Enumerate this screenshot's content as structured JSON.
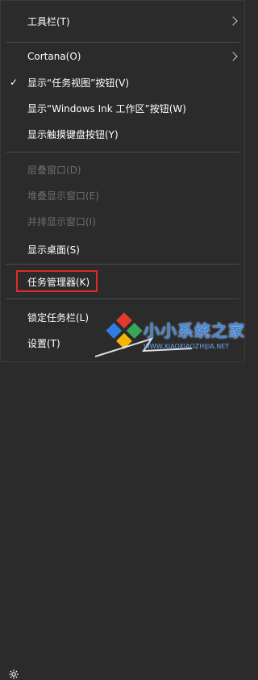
{
  "menu": {
    "items": [
      {
        "label": "工具栏(T)",
        "submenu": true
      },
      {
        "label": "Cortana(O)",
        "submenu": true
      },
      {
        "label": "显示“任务视图”按钮(V)",
        "checked": true
      },
      {
        "label": "显示“Windows Ink 工作区”按钮(W)"
      },
      {
        "label": "显示触摸键盘按钮(Y)"
      },
      {
        "label": "层叠窗口(D)",
        "disabled": true
      },
      {
        "label": "堆叠显示窗口(E)",
        "disabled": true
      },
      {
        "label": "并排显示窗口(I)",
        "disabled": true
      },
      {
        "label": "显示桌面(S)"
      },
      {
        "label": "任务管理器(K)",
        "highlighted": true
      },
      {
        "label": "锁定任务栏(L)"
      },
      {
        "label": "设置(T)",
        "icon": "gear-icon"
      }
    ],
    "check_glyph": "✓"
  },
  "watermark": {
    "text": "小小系统之家",
    "url": "WWW.XIAOXIAOZHIJIA.NET"
  },
  "colors": {
    "background": "#2b2b2b",
    "text": "#ffffff",
    "disabled_text": "#6e6e6e",
    "highlight_border": "#e02a2a",
    "watermark": "#3d86e0"
  }
}
